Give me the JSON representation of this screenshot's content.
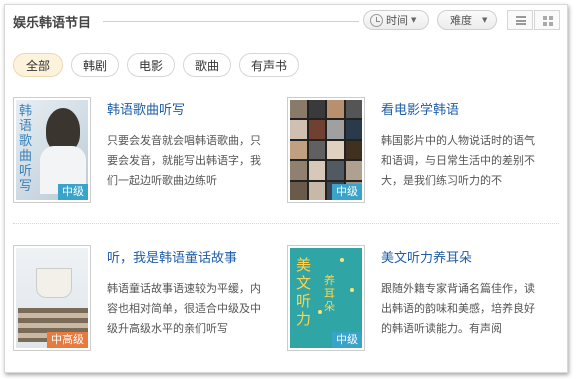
{
  "header": {
    "title": "娱乐韩语节目",
    "sort_time": "时间",
    "sort_difficulty": "难度",
    "colors": {
      "active_pill_bg": "#fdf3dc",
      "title_link": "#1e5ea8",
      "badge_mid": "#3aa3c9",
      "badge_high": "#e87a3e"
    }
  },
  "filters": [
    "全部",
    "韩剧",
    "电影",
    "歌曲",
    "有声书"
  ],
  "filter_selected": "全部",
  "cards": [
    {
      "title": "韩语歌曲听写",
      "description": "只要会发音就会唱韩语歌曲，只要会发音，就能写出韩语字，我们一起边听歌曲边练听",
      "level": "中级",
      "cover_text": "韩语歌曲听写"
    },
    {
      "title": "看电影学韩语",
      "description": "韩国影片中的人物说话时的语气和语调，与日常生活中的差别不大，是我们练习听力的不",
      "level": "中级"
    },
    {
      "title": "听，我是韩语童话故事",
      "description": "韩语童话故事语速较为平缓，内容也相对简单，很适合中级及中级升高级水平的亲们听写",
      "level": "中高级"
    },
    {
      "title": "美文听力养耳朵",
      "description": "跟随外籍专家背诵名篇佳作，读出韩语的韵味和美感，培养良好的韩语听读能力。有声阅",
      "level": "中级",
      "cover_text_main": "美文听力",
      "cover_text_side": "养耳朵"
    }
  ]
}
